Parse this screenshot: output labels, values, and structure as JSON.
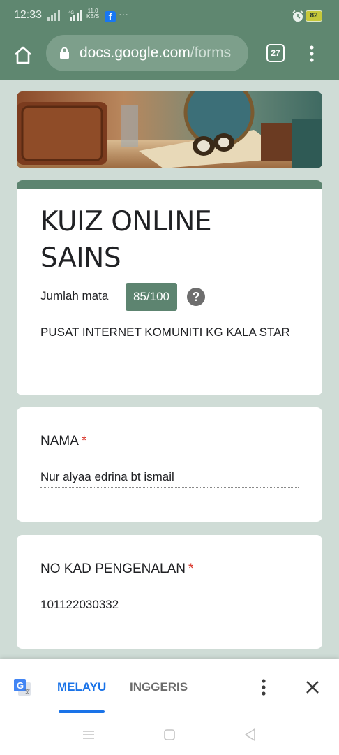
{
  "status_bar": {
    "time": "12:33",
    "signal1": "signal-icon",
    "signal2_label": "4G",
    "net_speed_value": "11.0",
    "net_speed_unit": "KB/S",
    "app_icon": "facebook-icon",
    "more": "···",
    "battery": "82"
  },
  "browser": {
    "url_domain": "docs.google.com",
    "url_path": "/forms",
    "tab_count": "27"
  },
  "form": {
    "title": "KUIZ ONLINE SAINS",
    "score_label": "Jumlah mata",
    "score": "85/100",
    "help": "?",
    "description": "PUSAT INTERNET KOMUNITI KG KALA STAR",
    "accent_color": "#5d8470",
    "questions": [
      {
        "label": "NAMA",
        "required": "*",
        "answer": "Nur alyaa edrina bt ismail"
      },
      {
        "label": "NO KAD PENGENALAN",
        "required": "*",
        "answer": "101122030332"
      }
    ]
  },
  "translate_bar": {
    "lang_active": "MELAYU",
    "lang_inactive": "INGGERIS",
    "active_color": "#1a73e8"
  }
}
